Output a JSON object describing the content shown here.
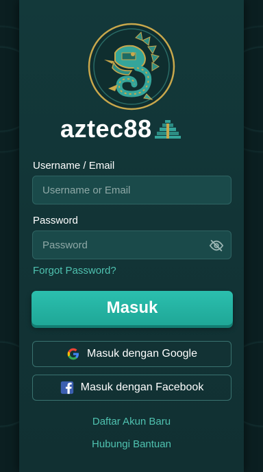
{
  "brand": {
    "name": "aztec88"
  },
  "login": {
    "username_label": "Username / Email",
    "username_placeholder": "Username or Email",
    "username_value": "",
    "password_label": "Password",
    "password_placeholder": "Password",
    "password_value": "",
    "forgot_label": "Forgot Password?",
    "submit_label": "Masuk"
  },
  "social": {
    "google_label": "Masuk dengan Google",
    "facebook_label": "Masuk dengan Facebook"
  },
  "footer": {
    "register_label": "Daftar Akun Baru",
    "help_label": "Hubungi Bantuan"
  },
  "colors": {
    "accent": "#22b3a2",
    "link": "#4fc2b0",
    "panel": "#123436",
    "gold": "#c9a84c"
  },
  "icons": [
    "aztec-serpent-emblem",
    "pyramid-icon",
    "eye-off-icon",
    "google-icon",
    "facebook-icon"
  ]
}
